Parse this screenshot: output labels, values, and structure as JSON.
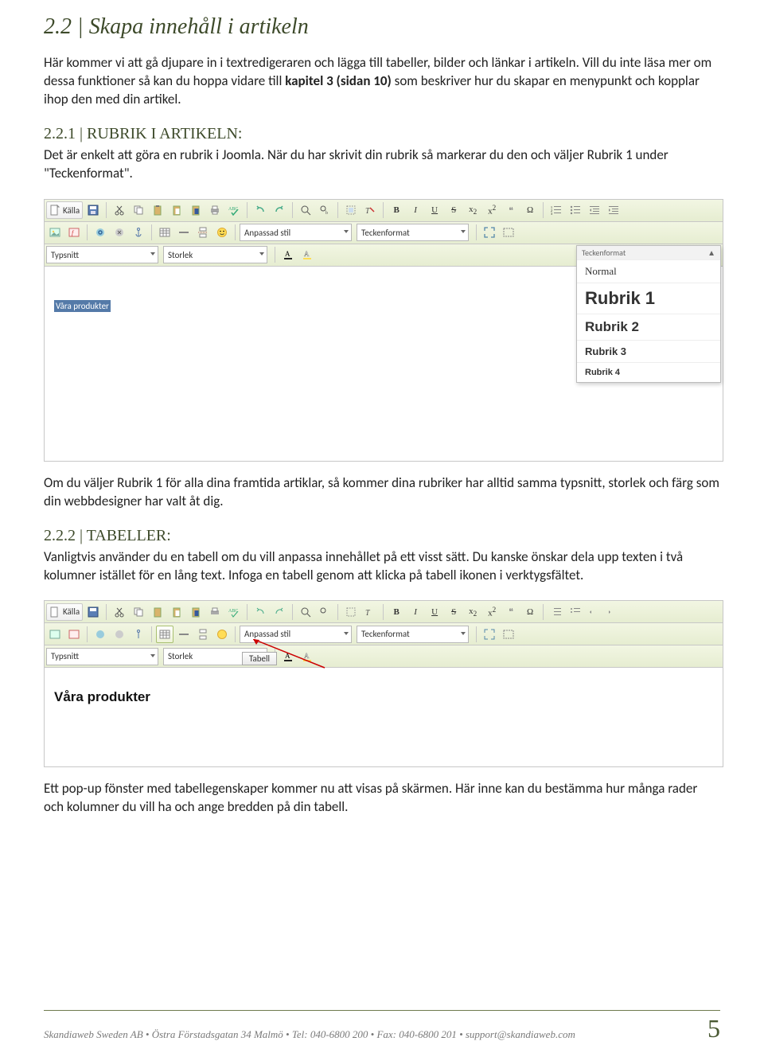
{
  "section": {
    "num": "2.2",
    "title": "Skapa innehåll i artikeln",
    "intro1": "Här kommer vi att gå djupare in i textredigeraren och lägga till tabeller, bilder och länkar i artikeln. Vill du inte läsa mer om dessa funktioner så kan du hoppa vidare till ",
    "intro_bold": "kapitel 3 (sidan 10)",
    "intro2": " som beskriver hur du skapar en menypunkt och kopplar ihop den med din artikel."
  },
  "s221": {
    "num": "2.2.1",
    "title": "RUBRIK I ARTIKELN:",
    "p": "Det är enkelt att göra en rubrik i Joomla. När du har skrivit din rubrik så markerar du den och väljer Rubrik 1 under \"Teckenformat\".",
    "after": "Om du väljer Rubrik 1 för alla dina framtida artiklar, så kommer dina rubriker har alltid samma typsnitt, storlek och färg som din webbdesigner har valt åt dig."
  },
  "s222": {
    "num": "2.2.2",
    "title": "TABELLER:",
    "p": "Vanligtvis använder du en tabell om du vill anpassa innehållet på ett visst sätt. Du kanske önskar dela upp texten i två kolumner istället för en lång text. Infoga en tabell genom att klicka på tabell ikonen i verktygsfältet.",
    "after": "Ett pop-up fönster med tabellegenskaper kommer nu att visas på skärmen. Här inne kan du bestämma hur många rader och kolumner du vill ha och ange bredden på din tabell."
  },
  "editor1": {
    "row3": {
      "font_label": "Typsnitt",
      "size_label": "Storlek"
    },
    "row2": {
      "style_label": "Anpassad stil",
      "format_label": "Teckenformat"
    },
    "kalla": "Källa",
    "selected_text": "Våra produkter",
    "dropdown": {
      "header": "Teckenformat",
      "items": [
        "Normal",
        "Rubrik 1",
        "Rubrik 2",
        "Rubrik 3",
        "Rubrik 4"
      ]
    }
  },
  "editor2": {
    "row3": {
      "font_label": "Typsnitt",
      "size_label": "Storlek"
    },
    "row2": {
      "style_label": "Anpassad stil",
      "format_label": "Teckenformat"
    },
    "kalla": "Källa",
    "tooltip": "Tabell",
    "heading": "Våra produkter"
  },
  "fmt": {
    "B": "B",
    "I": "I",
    "U": "U",
    "S": "S",
    "x2": "x",
    "quote": "❝",
    "omega": "Ω"
  },
  "footer": {
    "text": "Skandiaweb Sweden AB • Östra Förstadsgatan 34 Malmö • Tel: 040-6800 200 • Fax: 040-6800 201 • support@skandiaweb.com",
    "page": "5"
  }
}
